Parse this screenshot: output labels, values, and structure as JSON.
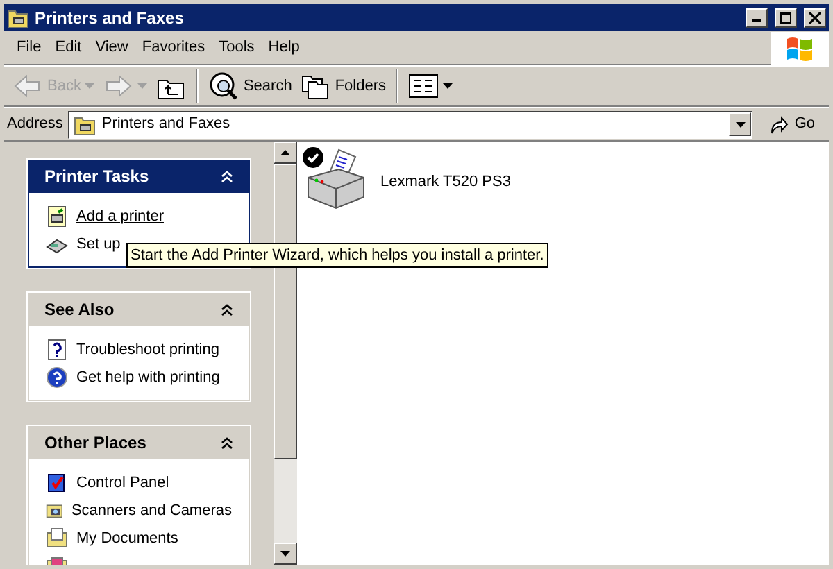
{
  "window": {
    "title": "Printers and Faxes"
  },
  "menu": [
    "File",
    "Edit",
    "View",
    "Favorites",
    "Tools",
    "Help"
  ],
  "toolbar": [
    {
      "kind": "back",
      "label": "Back",
      "disabled": true
    },
    {
      "kind": "forward",
      "disabled": true
    },
    {
      "kind": "up",
      "disabled": false
    },
    {
      "kind": "search",
      "label": "Search",
      "disabled": false
    },
    {
      "kind": "folders",
      "label": "Folders",
      "disabled": false
    },
    {
      "kind": "views",
      "disabled": false
    }
  ],
  "address": {
    "label": "Address",
    "value": "Printers and Faxes",
    "go": "Go"
  },
  "panels": [
    {
      "title": "Printer Tasks",
      "kind": "special",
      "items": [
        {
          "kind": "add-printer",
          "label": "Add a printer",
          "hovered": true
        },
        {
          "kind": "fax",
          "label": "Set up",
          "hovered": false
        }
      ]
    },
    {
      "title": "See Also",
      "kind": "normal",
      "items": [
        {
          "kind": "troubleshoot",
          "label": "Troubleshoot printing",
          "hovered": false
        },
        {
          "kind": "help",
          "label": "Get help with printing",
          "hovered": false
        }
      ]
    },
    {
      "title": "Other Places",
      "kind": "normal",
      "items": [
        {
          "kind": "control-panel",
          "label": "Control Panel",
          "hovered": false
        },
        {
          "kind": "scanner",
          "label": "Scanners and Cameras",
          "hovered": false
        },
        {
          "kind": "documents",
          "label": "My Documents",
          "hovered": false
        },
        {
          "kind": "pictures"
        }
      ]
    }
  ],
  "printers": [
    {
      "name": "Lexmark T520 PS3",
      "default": true
    }
  ],
  "tooltip": "Start the Add Printer Wizard, which helps you install a printer."
}
